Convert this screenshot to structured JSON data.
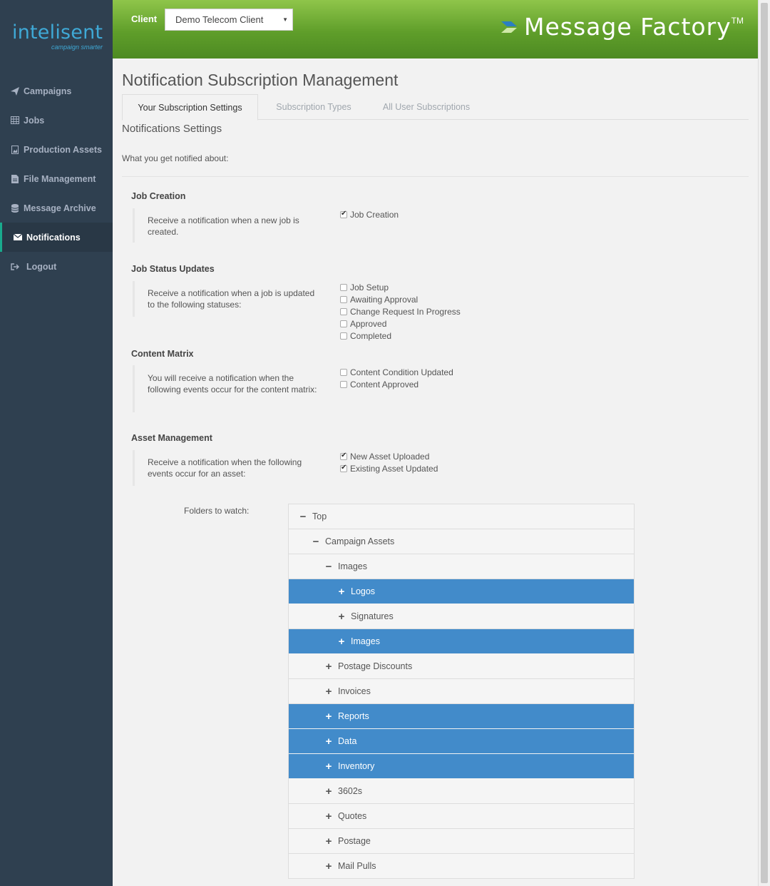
{
  "logo": {
    "text": "intelisent",
    "tagline": "campaign smarter"
  },
  "sidebar": {
    "items": [
      {
        "label": "Campaigns",
        "icon": "paper-plane-icon"
      },
      {
        "label": "Jobs",
        "icon": "table-icon"
      },
      {
        "label": "Production Assets",
        "icon": "image-file-icon"
      },
      {
        "label": "File Management",
        "icon": "file-icon"
      },
      {
        "label": "Message Archive",
        "icon": "database-icon"
      },
      {
        "label": "Notifications",
        "icon": "envelope-icon",
        "active": true
      },
      {
        "label": "Logout",
        "icon": "sign-out-icon"
      }
    ]
  },
  "header": {
    "client_label": "Client",
    "client_value": "Demo Telecom Client",
    "brand": "Message Factory",
    "brand_tm": "TM"
  },
  "page": {
    "title": "Notification Subscription Management",
    "tabs": [
      {
        "label": "Your Subscription Settings",
        "active": true
      },
      {
        "label": "Subscription Types"
      },
      {
        "label": "All User Subscriptions"
      }
    ],
    "section_heading": "Notifications Settings",
    "subtext": "What you get notified about:"
  },
  "groups": [
    {
      "title": "Job Creation",
      "description": "Receive a notification when a new job is created.",
      "options": [
        {
          "label": "Job Creation",
          "checked": true
        }
      ]
    },
    {
      "title": "Job Status Updates",
      "description": "Receive a notification when a job is updated to the following statuses:",
      "options": [
        {
          "label": "Job Setup",
          "checked": false
        },
        {
          "label": "Awaiting Approval",
          "checked": false
        },
        {
          "label": "Change Request In Progress",
          "checked": false
        },
        {
          "label": "Approved",
          "checked": false
        },
        {
          "label": "Completed",
          "checked": false
        }
      ]
    },
    {
      "title": "Content Matrix",
      "description": "You will receive a notification when the following events occur for the content matrix:",
      "options": [
        {
          "label": "Content Condition Updated",
          "checked": false
        },
        {
          "label": "Content Approved",
          "checked": false
        }
      ]
    },
    {
      "title": "Asset Management",
      "description": "Receive a notification when the following events occur for an asset:",
      "options": [
        {
          "label": "New Asset Uploaded",
          "checked": true
        },
        {
          "label": "Existing Asset Updated",
          "checked": true
        }
      ]
    }
  ],
  "folders": {
    "label": "Folders to watch:",
    "tree": [
      {
        "label": "Top",
        "level": 0,
        "expanded": true,
        "selected": false
      },
      {
        "label": "Campaign Assets",
        "level": 1,
        "expanded": true,
        "selected": false
      },
      {
        "label": "Images",
        "level": 2,
        "expanded": true,
        "selected": false
      },
      {
        "label": "Logos",
        "level": 3,
        "expanded": false,
        "selected": true
      },
      {
        "label": "Signatures",
        "level": 3,
        "expanded": false,
        "selected": false
      },
      {
        "label": "Images",
        "level": 3,
        "expanded": false,
        "selected": true
      },
      {
        "label": "Postage Discounts",
        "level": 2,
        "expanded": false,
        "selected": false
      },
      {
        "label": "Invoices",
        "level": 2,
        "expanded": false,
        "selected": false
      },
      {
        "label": "Reports",
        "level": 2,
        "expanded": false,
        "selected": true
      },
      {
        "label": "Data",
        "level": 2,
        "expanded": false,
        "selected": true
      },
      {
        "label": "Inventory",
        "level": 2,
        "expanded": false,
        "selected": true
      },
      {
        "label": "3602s",
        "level": 2,
        "expanded": false,
        "selected": false
      },
      {
        "label": "Quotes",
        "level": 2,
        "expanded": false,
        "selected": false
      },
      {
        "label": "Postage",
        "level": 2,
        "expanded": false,
        "selected": false
      },
      {
        "label": "Mail Pulls",
        "level": 2,
        "expanded": false,
        "selected": false
      }
    ]
  },
  "colors": {
    "sidebar_bg": "#2f4050",
    "accent_green": "#19aa8d",
    "header_green": "#5f9e2a",
    "selected_blue": "#428bca"
  }
}
